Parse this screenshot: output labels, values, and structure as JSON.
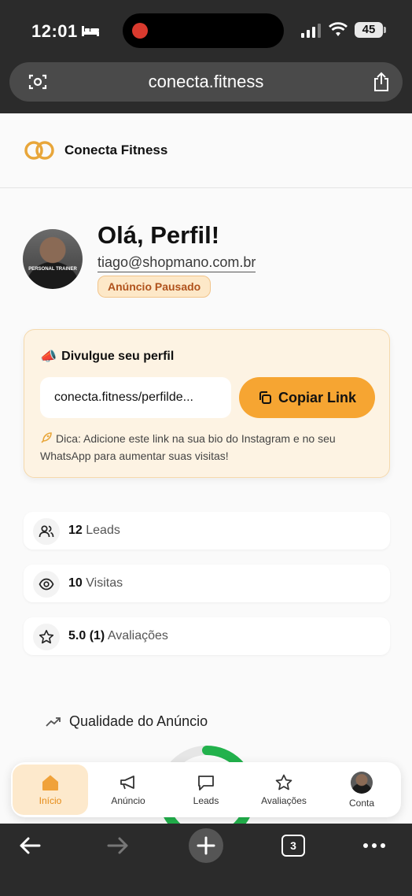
{
  "status_bar": {
    "time": "12:01",
    "battery": "45"
  },
  "browser": {
    "url": "conecta.fitness",
    "tab_count": "3"
  },
  "header": {
    "brand": "Conecta Fitness"
  },
  "profile": {
    "greeting": "Olá, Perfil!",
    "email": "tiago@shopmano.com.br",
    "status_badge": "Anúncio Pausado",
    "avatar_shirt_text": "PERSONAL TRAINER"
  },
  "promo": {
    "title": "Divulgue seu perfil",
    "link": "conecta.fitness/perfilde...",
    "copy_button": "Copiar Link",
    "tip": "Dica: Adicione este link na sua bio do Instagram e no seu WhatsApp para aumentar suas visitas!"
  },
  "stats": [
    {
      "value": "12",
      "label": "Leads",
      "icon": "users-icon"
    },
    {
      "value": "10",
      "label": "Visitas",
      "icon": "eye-icon"
    },
    {
      "value": "5.0 (1)",
      "label": "Avaliações",
      "icon": "star-icon"
    }
  ],
  "quality": {
    "title": "Qualidade do Anúncio",
    "colors": {
      "track": "#e6e6e6",
      "progress": "#22b24c"
    }
  },
  "tabs": [
    {
      "label": "Início",
      "icon": "home-icon",
      "active": true
    },
    {
      "label": "Anúncio",
      "icon": "megaphone-icon"
    },
    {
      "label": "Leads",
      "icon": "message-icon"
    },
    {
      "label": "Avaliações",
      "icon": "star-icon"
    },
    {
      "label": "Conta",
      "icon": "avatar"
    }
  ],
  "colors": {
    "accent": "#f6a532",
    "active_tab": "#e58a14",
    "badge_text": "#b0521c"
  }
}
